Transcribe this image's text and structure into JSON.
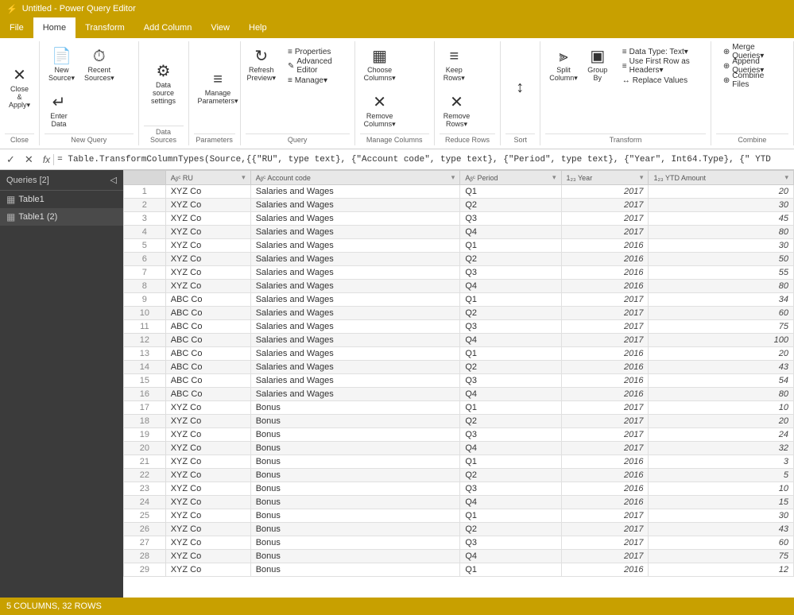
{
  "titleBar": {
    "title": "Untitled - Power Query Editor",
    "icon": "⚡"
  },
  "ribbon": {
    "tabs": [
      {
        "label": "File",
        "active": false
      },
      {
        "label": "Home",
        "active": true
      },
      {
        "label": "Transform",
        "active": false
      },
      {
        "label": "Add Column",
        "active": false
      },
      {
        "label": "View",
        "active": false
      },
      {
        "label": "Help",
        "active": false
      }
    ],
    "groups": [
      {
        "name": "close",
        "label": "Close",
        "buttons": [
          {
            "icon": "✕",
            "label": "Close &\nApply▾"
          }
        ]
      },
      {
        "name": "new-query",
        "label": "New Query",
        "buttons": [
          {
            "icon": "📄",
            "label": "New\nSource▾"
          },
          {
            "icon": "⏱",
            "label": "Recent\nSources▾"
          },
          {
            "icon": "↵",
            "label": "Enter\nData"
          }
        ]
      },
      {
        "name": "data-sources",
        "label": "Data Sources",
        "buttons": [
          {
            "icon": "⚙",
            "label": "Data source\nsettings"
          }
        ]
      },
      {
        "name": "parameters",
        "label": "Parameters",
        "buttons": [
          {
            "icon": "≡",
            "label": "Manage\nParameters▾"
          }
        ]
      },
      {
        "name": "query",
        "label": "Query",
        "buttons": [
          {
            "icon": "↻",
            "label": "Refresh\nPreview▾"
          }
        ],
        "smButtons": [
          {
            "icon": "≡",
            "label": "Properties"
          },
          {
            "icon": "✎",
            "label": "Advanced Editor"
          },
          {
            "icon": "≡",
            "label": "Manage▾"
          }
        ]
      },
      {
        "name": "manage-columns",
        "label": "Manage Columns",
        "buttons": [
          {
            "icon": "▦",
            "label": "Choose\nColumns▾"
          },
          {
            "icon": "✕",
            "label": "Remove\nColumns▾"
          }
        ]
      },
      {
        "name": "reduce-rows",
        "label": "Reduce Rows",
        "buttons": [
          {
            "icon": "≡",
            "label": "Keep\nRows▾"
          },
          {
            "icon": "✕",
            "label": "Remove\nRows▾"
          }
        ]
      },
      {
        "name": "sort",
        "label": "Sort",
        "buttons": [
          {
            "icon": "↕",
            "label": ""
          }
        ]
      },
      {
        "name": "transform",
        "label": "Transform",
        "buttons": [
          {
            "icon": "⫸",
            "label": "Split\nColumn▾"
          },
          {
            "icon": "▣",
            "label": "Group\nBy"
          }
        ],
        "smButtons": [
          {
            "icon": "≡",
            "label": "Data Type: Text▾"
          },
          {
            "icon": "≡",
            "label": "Use First Row as Headers▾"
          },
          {
            "icon": "↔",
            "label": "Replace Values"
          }
        ]
      },
      {
        "name": "combine",
        "label": "Combine",
        "smButtons": [
          {
            "icon": "⊕",
            "label": "Merge Queries▾"
          },
          {
            "icon": "⊕",
            "label": "Append Queries▾"
          },
          {
            "icon": "⊕",
            "label": "Combine Files"
          }
        ]
      }
    ]
  },
  "formulaBar": {
    "checkIcon": "✓",
    "crossIcon": "✕",
    "fx": "fx",
    "formula": "= Table.TransformColumnTypes(Source,{{\"RU\", type text}, {\"Account code\", type text}, {\"Period\", type text}, {\"Year\", Int64.Type}, {\" YTD"
  },
  "sidebar": {
    "title": "Queries [2]",
    "collapseIcon": "◁",
    "items": [
      {
        "label": "Table1",
        "icon": "▦",
        "active": false
      },
      {
        "label": "Table1 (2)",
        "icon": "▦",
        "active": true
      }
    ]
  },
  "table": {
    "columns": [
      {
        "id": "row-num",
        "label": "",
        "type": ""
      },
      {
        "id": "RU",
        "label": "RU",
        "type": "ABC",
        "typeIcon": "Aᵦᶜ"
      },
      {
        "id": "account-code",
        "label": "Account code",
        "type": "ABC",
        "typeIcon": "Aᵦᶜ"
      },
      {
        "id": "period",
        "label": "Period",
        "type": "ABC",
        "typeIcon": "Aᵦᶜ"
      },
      {
        "id": "year",
        "label": "Year",
        "type": "123",
        "typeIcon": "1₂₃"
      },
      {
        "id": "ytd-amount",
        "label": "YTD Amount",
        "type": "123",
        "typeIcon": "1₂₃"
      }
    ],
    "rows": [
      [
        1,
        "XYZ Co",
        "Salaries and Wages",
        "Q1",
        2017,
        20
      ],
      [
        2,
        "XYZ Co",
        "Salaries and Wages",
        "Q2",
        2017,
        30
      ],
      [
        3,
        "XYZ Co",
        "Salaries and Wages",
        "Q3",
        2017,
        45
      ],
      [
        4,
        "XYZ Co",
        "Salaries and Wages",
        "Q4",
        2017,
        80
      ],
      [
        5,
        "XYZ Co",
        "Salaries and Wages",
        "Q1",
        2016,
        30
      ],
      [
        6,
        "XYZ Co",
        "Salaries and Wages",
        "Q2",
        2016,
        50
      ],
      [
        7,
        "XYZ Co",
        "Salaries and Wages",
        "Q3",
        2016,
        55
      ],
      [
        8,
        "XYZ Co",
        "Salaries and Wages",
        "Q4",
        2016,
        80
      ],
      [
        9,
        "ABC Co",
        "Salaries and Wages",
        "Q1",
        2017,
        34
      ],
      [
        10,
        "ABC Co",
        "Salaries and Wages",
        "Q2",
        2017,
        60
      ],
      [
        11,
        "ABC Co",
        "Salaries and Wages",
        "Q3",
        2017,
        75
      ],
      [
        12,
        "ABC Co",
        "Salaries and Wages",
        "Q4",
        2017,
        100
      ],
      [
        13,
        "ABC Co",
        "Salaries and Wages",
        "Q1",
        2016,
        20
      ],
      [
        14,
        "ABC Co",
        "Salaries and Wages",
        "Q2",
        2016,
        43
      ],
      [
        15,
        "ABC Co",
        "Salaries and Wages",
        "Q3",
        2016,
        54
      ],
      [
        16,
        "ABC Co",
        "Salaries and Wages",
        "Q4",
        2016,
        80
      ],
      [
        17,
        "XYZ Co",
        "Bonus",
        "Q1",
        2017,
        10
      ],
      [
        18,
        "XYZ Co",
        "Bonus",
        "Q2",
        2017,
        20
      ],
      [
        19,
        "XYZ Co",
        "Bonus",
        "Q3",
        2017,
        24
      ],
      [
        20,
        "XYZ Co",
        "Bonus",
        "Q4",
        2017,
        32
      ],
      [
        21,
        "XYZ Co",
        "Bonus",
        "Q1",
        2016,
        3
      ],
      [
        22,
        "XYZ Co",
        "Bonus",
        "Q2",
        2016,
        5
      ],
      [
        23,
        "XYZ Co",
        "Bonus",
        "Q3",
        2016,
        10
      ],
      [
        24,
        "XYZ Co",
        "Bonus",
        "Q4",
        2016,
        15
      ],
      [
        25,
        "XYZ Co",
        "Bonus",
        "Q1",
        2017,
        30
      ],
      [
        26,
        "XYZ Co",
        "Bonus",
        "Q2",
        2017,
        43
      ],
      [
        27,
        "XYZ Co",
        "Bonus",
        "Q3",
        2017,
        60
      ],
      [
        28,
        "XYZ Co",
        "Bonus",
        "Q4",
        2017,
        75
      ],
      [
        29,
        "XYZ Co",
        "Bonus",
        "Q1",
        2016,
        12
      ]
    ]
  },
  "statusBar": {
    "text": "5 COLUMNS, 32 ROWS"
  },
  "colors": {
    "accent": "#c8a000",
    "sidebar": "#3b3b3b",
    "ribbonActive": "#ffffff",
    "ribbonInactive": "#c8a000"
  }
}
